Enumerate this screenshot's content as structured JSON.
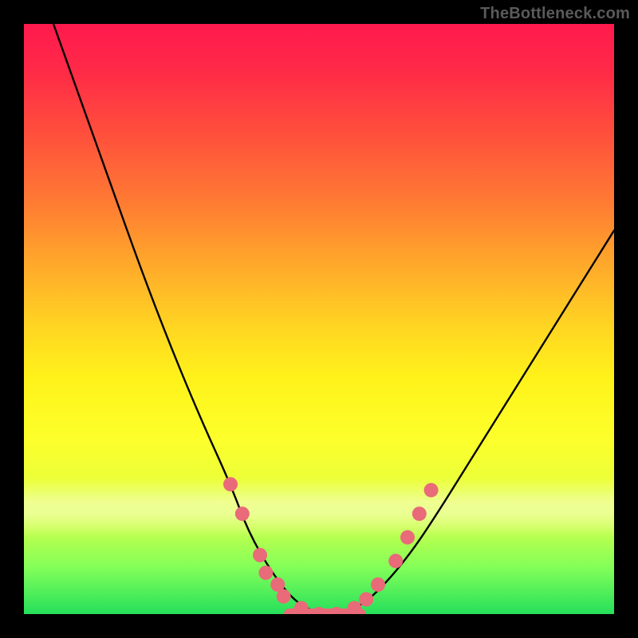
{
  "watermark": {
    "text": "TheBottleneck.com"
  },
  "chart_data": {
    "type": "line",
    "title": "",
    "xlabel": "",
    "ylabel": "",
    "xlim": [
      0,
      100
    ],
    "ylim": [
      0,
      100
    ],
    "grid": false,
    "legend": false,
    "description": "Bottleneck-style V-curve. Y ≈ 0 at the trough and rises steeply on both sides. X is a normalized component ratio; Y is approximate bottleneck percentage.",
    "series": [
      {
        "name": "bottleneck-curve",
        "x": [
          5,
          10,
          15,
          20,
          25,
          30,
          35,
          38,
          42,
          46,
          50,
          54,
          58,
          62,
          66,
          70,
          75,
          80,
          85,
          90,
          95,
          100
        ],
        "values": [
          100,
          86,
          72,
          58,
          45,
          33,
          22,
          14,
          7,
          2,
          0,
          0,
          2,
          6,
          11,
          17,
          25,
          33,
          41,
          49,
          57,
          65
        ]
      }
    ],
    "markers": {
      "name": "highlight-dots",
      "color": "#e96a78",
      "radius_px": 9,
      "points": [
        {
          "x": 35,
          "y": 22
        },
        {
          "x": 37,
          "y": 17
        },
        {
          "x": 40,
          "y": 10
        },
        {
          "x": 41,
          "y": 7
        },
        {
          "x": 43,
          "y": 5
        },
        {
          "x": 44,
          "y": 3
        },
        {
          "x": 47,
          "y": 1
        },
        {
          "x": 50,
          "y": 0
        },
        {
          "x": 53,
          "y": 0
        },
        {
          "x": 56,
          "y": 1
        },
        {
          "x": 58,
          "y": 2.5
        },
        {
          "x": 60,
          "y": 5
        },
        {
          "x": 63,
          "y": 9
        },
        {
          "x": 65,
          "y": 13
        },
        {
          "x": 67,
          "y": 17
        },
        {
          "x": 69,
          "y": 21
        }
      ]
    },
    "trough_bar": {
      "name": "flat-trough-segment",
      "color": "#e96a78",
      "x_start": 45,
      "x_end": 57,
      "y": 0,
      "thickness_px": 14
    }
  }
}
